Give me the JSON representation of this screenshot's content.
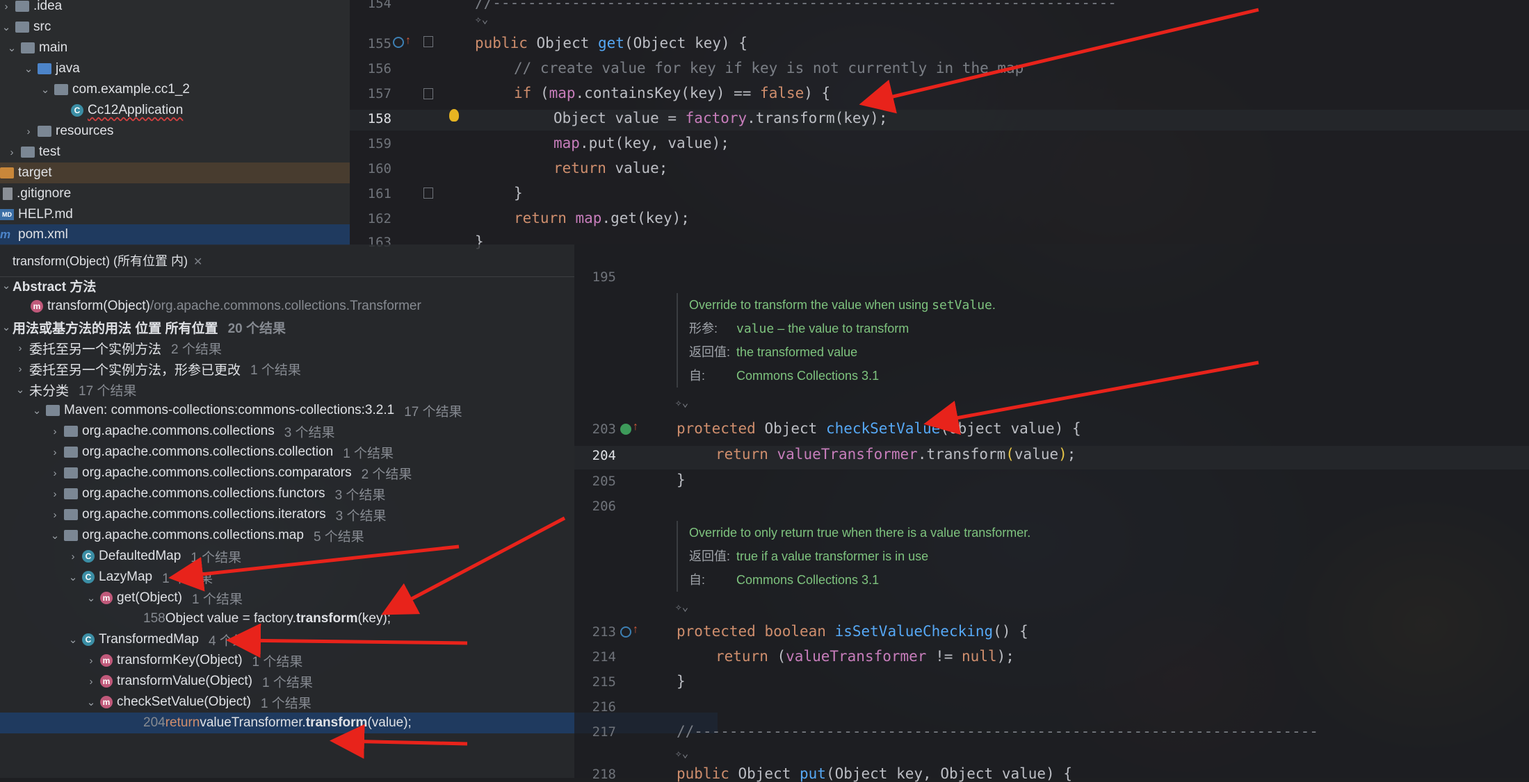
{
  "project_tree": [
    {
      "label": ".idea",
      "indent": 0,
      "icon": "folder-icon",
      "expanded": false
    },
    {
      "label": "src",
      "indent": 0,
      "icon": "folder-icon",
      "expanded": true
    },
    {
      "label": "main",
      "indent": 1,
      "icon": "folder-icon",
      "expanded": true
    },
    {
      "label": "java",
      "indent": 2,
      "icon": "folder-blue-icon",
      "expanded": true
    },
    {
      "label": "com.example.cc1_2",
      "indent": 3,
      "icon": "package-icon",
      "expanded": true
    },
    {
      "label": "Cc12Application",
      "indent": 4,
      "icon": "spring-class-icon",
      "expanded": null
    },
    {
      "label": "resources",
      "indent": 2,
      "icon": "resources-folder-icon",
      "expanded": false
    },
    {
      "label": "test",
      "indent": 1,
      "icon": "folder-icon",
      "expanded": false
    },
    {
      "label": "target",
      "indent": 0,
      "icon": "folder-orange-icon",
      "expanded": false
    },
    {
      "label": ".gitignore",
      "indent": 0,
      "icon": "file-icon",
      "expanded": null
    },
    {
      "label": "HELP.md",
      "indent": 0,
      "icon": "md-icon",
      "expanded": null
    },
    {
      "label": "pom.xml",
      "indent": 0,
      "icon": "maven-icon",
      "expanded": null
    }
  ],
  "top_editor": {
    "lines": [
      "154",
      "155",
      "156",
      "157",
      "158",
      "159",
      "160",
      "161",
      "162",
      "163"
    ],
    "code": {
      "sep": "//-----------------------------------------------------------------------",
      "l155_kw": "public",
      "l155_type": " Object ",
      "l155_fn": "get",
      "l155_rest": "(Object key) {",
      "l156": "// create value for key if key is not currently in the map",
      "l157_kw": "if",
      "l157_a": " (",
      "l157_fld": "map",
      "l157_b": ".containsKey(key) == ",
      "l157_kw2": "false",
      "l157_c": ") {",
      "l158_a": "Object value = ",
      "l158_fld": "factory",
      "l158_b": ".transform(key);",
      "l159_fld": "map",
      "l159_b": ".put(key, value);",
      "l160_kw": "return",
      "l160_b": " value;",
      "l161": "}",
      "l162_kw": "return",
      "l162_a": " ",
      "l162_fld": "map",
      "l162_b": ".get(key);",
      "l163": "}"
    }
  },
  "find_panel": {
    "tab_title": "transform(Object) (所有位置 内)",
    "abstract_header": "Abstract 方法",
    "abstract_item": "transform(Object)",
    "abstract_item_path": " /org.apache.commons.collections.Transformer",
    "usages_header": "用法或基方法的用法 位置 所有位置",
    "usages_count": "20 个结果",
    "groups": [
      {
        "label": "委托至另一个实例方法",
        "count": "2 个结果"
      },
      {
        "label": "委托至另一个实例方法，形参已更改",
        "count": "1 个结果"
      },
      {
        "label": "未分类",
        "count": "17 个结果"
      }
    ],
    "maven_label": "Maven: commons-collections:commons-collections:3.2.1",
    "maven_count": "17 个结果",
    "packages": [
      {
        "label": "org.apache.commons.collections",
        "count": "3 个结果"
      },
      {
        "label": "org.apache.commons.collections.collection",
        "count": "1 个结果"
      },
      {
        "label": "org.apache.commons.collections.comparators",
        "count": "2 个结果"
      },
      {
        "label": "org.apache.commons.collections.functors",
        "count": "3 个结果"
      },
      {
        "label": "org.apache.commons.collections.iterators",
        "count": "3 个结果"
      },
      {
        "label": "org.apache.commons.collections.map",
        "count": "5 个结果"
      }
    ],
    "classes": {
      "defaulted": {
        "label": "DefaultedMap",
        "count": "1 个结果"
      },
      "lazy": {
        "label": "LazyMap",
        "count": "1 个结果"
      },
      "lazy_get": {
        "label": "get(Object)",
        "count": "1 个结果"
      },
      "lazy_hit_line": "158",
      "lazy_hit_a": " Object value = factory.",
      "lazy_hit_b": "transform",
      "lazy_hit_c": "(key);",
      "transformed": {
        "label": "TransformedMap",
        "count": "4 个结果"
      },
      "t_key": {
        "label": "transformKey(Object)",
        "count": "1 个结果"
      },
      "t_value": {
        "label": "transformValue(Object)",
        "count": "1 个结果"
      },
      "t_check": {
        "label": "checkSetValue(Object)",
        "count": "1 个结果"
      },
      "check_hit_line": "204",
      "check_hit_kw": " return",
      "check_hit_a": " valueTransformer.",
      "check_hit_b": "transform",
      "check_hit_c": "(value);"
    }
  },
  "bottom_editor": {
    "lines": {
      "l195": "195",
      "l203": "203",
      "l204": "204",
      "l205": "205",
      "l206": "206",
      "l213": "213",
      "l214": "214",
      "l215": "215",
      "l216": "216",
      "l217": "217",
      "l218": "218"
    },
    "doc1": {
      "text_a": "Override to transform the value when using ",
      "text_code": "setValue",
      "text_b": ".",
      "param_key": "形参:",
      "param_code": "value",
      "param_val": " – the value to transform",
      "return_key": "返回值:",
      "return_val": "the transformed value",
      "since_key": "自:",
      "since_val": "Commons Collections 3.1"
    },
    "doc2": {
      "text": "Override to only return true when there is a value transformer.",
      "return_key": "返回值:",
      "return_val": "true if a value transformer is in use",
      "since_key": "自:",
      "since_val": "Commons Collections 3.1"
    },
    "code": {
      "l203_kw": "protected",
      "l203_a": " Object ",
      "l203_fn": "checkSetValue",
      "l203_b": "(Object value) {",
      "l204_kw": "return",
      "l204_a": " ",
      "l204_fld": "valueTransformer",
      "l204_b": ".transform",
      "l204_p1": "(",
      "l204_c": "value",
      "l204_p2": ")",
      "l204_d": ";",
      "l205": "}",
      "l213_kw": "protected",
      "l213_kw2": " boolean ",
      "l213_fn": "isSetValueChecking",
      "l213_b": "() {",
      "l214_kw": "return",
      "l214_a": " (",
      "l214_fld": "valueTransformer",
      "l214_b": " != ",
      "l214_kw2": "null",
      "l214_c": ");",
      "l215": "}",
      "l217": "//-----------------------------------------------------------------------",
      "l218_kw": "public",
      "l218_a": " Object ",
      "l218_fn": "put",
      "l218_b": "(Object key, Object value) {"
    }
  },
  "colors": {
    "arrow": "#e8231b",
    "keyword": "#cf8e6d",
    "function": "#56a8f5",
    "field": "#c77dbb",
    "doc": "#7ec37e"
  }
}
